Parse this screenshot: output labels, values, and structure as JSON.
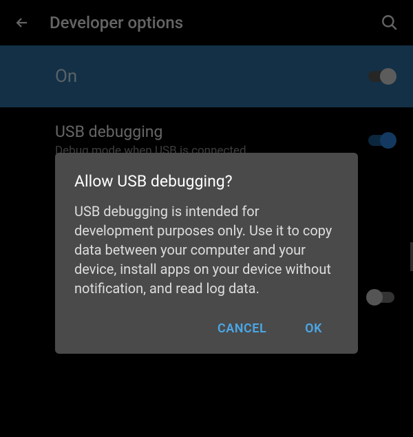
{
  "header": {
    "title": "Developer options"
  },
  "master_toggle": {
    "label": "On",
    "state": true
  },
  "settings": [
    {
      "title": "USB debugging",
      "subtitle": "Debug mode when USB is connected",
      "state": true
    }
  ],
  "dialog": {
    "title": "Allow USB debugging?",
    "body": "USB debugging is intended for development purposes only. Use it to copy data between your computer and your device, install apps on your device without notification, and read log data.",
    "cancel": "CANCEL",
    "ok": "OK"
  }
}
